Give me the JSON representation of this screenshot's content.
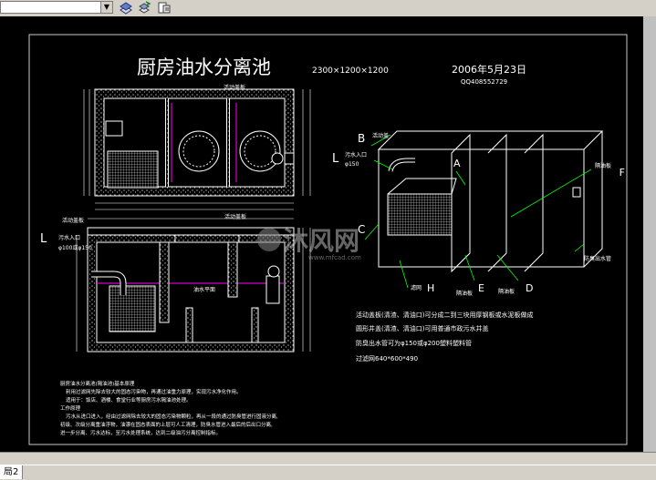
{
  "toolbar": {
    "layer_value": "",
    "icons": [
      "layer-properties-icon",
      "layer-previous-icon",
      "layer-states-icon"
    ]
  },
  "drawing": {
    "title": "厨房油水分离池",
    "size_spec": "2300×1200×1200",
    "date": "2006年5月23日",
    "code": "QQ408552729",
    "plan_labels": {
      "top_board": "活动盖板"
    },
    "section_labels": {
      "movable_board": "活动盖板",
      "inlet": "污水入口",
      "inlet_pipe": "φ100或φ150",
      "cover_plate": "活动盖板",
      "water_level": "油水平面"
    },
    "iso_labels": {
      "B": "B",
      "B_text": "活动盖",
      "L": "L",
      "inlet": "污水入口",
      "inlet_pipe": "φ150",
      "A": "A",
      "F": "F",
      "F_text": "隔油板",
      "C": "C",
      "E": "E",
      "D": "D",
      "H": "H",
      "H_text": "滤网",
      "sep1": "隔油板",
      "sep2": "隔油板",
      "outlet": "防臭出水管"
    },
    "notes_right": [
      "活动盖板(清渣、清油口)可分成二到三块用厚钢板或水泥板做成",
      "圆形井盖(清渣、清油口)可用普通市政污水井盖",
      "防臭出水管可为φ150或φ200塑料塑料管",
      "过滤网640*600*490"
    ],
    "notes_bottom_title": "厨房油水分离池(隔油池)基本原理",
    "notes_bottom": [
      "利用过滤网先除去较大的固态污染物，再通过油重力原理，实现污水净化作用。",
      "适用于：饭店、酒楼、食堂行业等厨房污水隔油池处理。",
      "工作原理",
      "污水从进口进入，经由过滤网除去较大的固态污染物颗粒，再从一段的通过防臭管进行固液分离,",
      "初级、次级分离重油浮物，油漂在固态表面的上层可人工清理，防臭水管进入最后的后出口分离,",
      "进一步分离、污水达标，至污水处理系统，达到二级油污分离控制指标。"
    ],
    "watermark": "沐风网",
    "watermark_url": "www.mfcad.com"
  },
  "status": {
    "tab_label": "局2"
  },
  "colors": {
    "canvas": "#000000",
    "line": "#ffffff",
    "magenta": "#ff00ff",
    "green": "#00ff00",
    "frame": "#c8c8c8"
  }
}
